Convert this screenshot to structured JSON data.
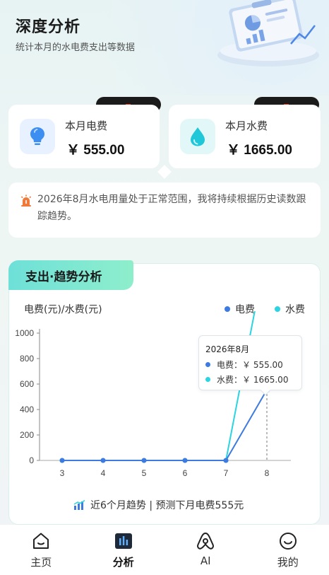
{
  "header": {
    "title": "深度分析",
    "subtitle": "统计本月的水电费支出等数据"
  },
  "cards": {
    "electricity": {
      "label": "本月电费",
      "value": "￥ 555.00",
      "icon": "lightbulb-icon",
      "icon_color": "#3c8ef0"
    },
    "water": {
      "label": "本月水费",
      "value": "￥ 1665.00",
      "icon": "water-drop-icon",
      "icon_color": "#1fc7d8"
    }
  },
  "notice": {
    "icon": "alarm-icon",
    "text": "2026年8月水电用量处于正常范围，我将持续根据历史读数跟踪趋势。"
  },
  "trend": {
    "tab_title": "支出·趋势分析",
    "footer": "近6个月趋势 | 预测下月电费555元"
  },
  "chart_data": {
    "type": "line",
    "ylabel": "电费(元)/水费(元)",
    "x": [
      "3",
      "4",
      "5",
      "6",
      "7",
      "8"
    ],
    "ylim": [
      0,
      1000
    ],
    "series": [
      {
        "name": "电费",
        "color": "#3d7be0",
        "values": [
          0,
          0,
          0,
          0,
          0,
          555
        ]
      },
      {
        "name": "水费",
        "color": "#2ad4e0",
        "values": [
          0,
          0,
          0,
          0,
          0,
          1665
        ]
      }
    ],
    "tooltip": {
      "title": "2026年8月",
      "rows": [
        {
          "label": "电费：",
          "value": "￥ 555.00"
        },
        {
          "label": "水费：",
          "value": "￥ 1665.00"
        }
      ]
    }
  },
  "tabbar": {
    "items": [
      {
        "label": "主页",
        "icon": "home-icon",
        "active": false
      },
      {
        "label": "分析",
        "icon": "analytics-icon",
        "active": true
      },
      {
        "label": "AI",
        "icon": "ai-icon",
        "active": false
      },
      {
        "label": "我的",
        "icon": "profile-icon",
        "active": false
      }
    ]
  },
  "colors": {
    "accent": "#3d7be0",
    "water": "#2ad4e0",
    "tab_gradient_start": "#6ee0d8",
    "tab_gradient_end": "#8eeecc"
  }
}
